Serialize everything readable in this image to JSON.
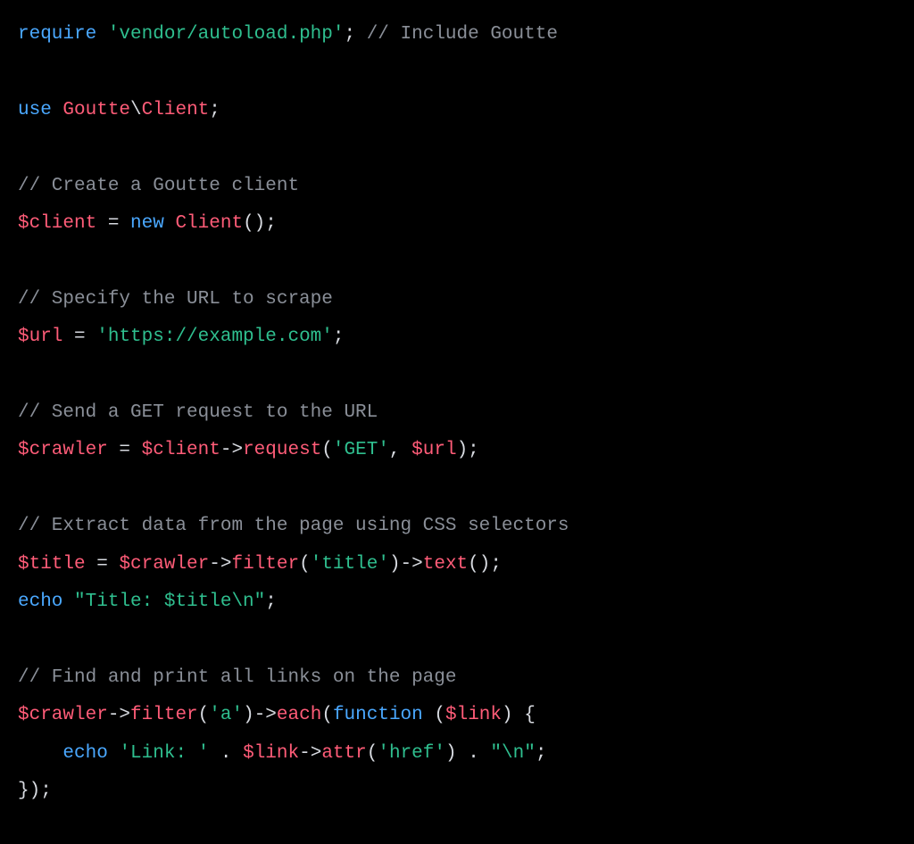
{
  "code": {
    "lines": [
      [
        {
          "cls": "tok-keyword",
          "text": "require"
        },
        {
          "cls": "tok-punct",
          "text": " "
        },
        {
          "cls": "tok-string",
          "text": "'vendor/autoload.php'"
        },
        {
          "cls": "tok-punct",
          "text": ";"
        },
        {
          "cls": "tok-punct",
          "text": " "
        },
        {
          "cls": "tok-comment",
          "text": "// Include Goutte"
        }
      ],
      [],
      [
        {
          "cls": "tok-keyword",
          "text": "use"
        },
        {
          "cls": "tok-punct",
          "text": " "
        },
        {
          "cls": "tok-class",
          "text": "Goutte"
        },
        {
          "cls": "tok-punct",
          "text": "\\"
        },
        {
          "cls": "tok-class",
          "text": "Client"
        },
        {
          "cls": "tok-punct",
          "text": ";"
        }
      ],
      [],
      [
        {
          "cls": "tok-comment",
          "text": "// Create a Goutte client"
        }
      ],
      [
        {
          "cls": "tok-var",
          "text": "$client"
        },
        {
          "cls": "tok-punct",
          "text": " = "
        },
        {
          "cls": "tok-keyword",
          "text": "new"
        },
        {
          "cls": "tok-punct",
          "text": " "
        },
        {
          "cls": "tok-class",
          "text": "Client"
        },
        {
          "cls": "tok-punct",
          "text": "();"
        }
      ],
      [],
      [
        {
          "cls": "tok-comment",
          "text": "// Specify the URL to scrape"
        }
      ],
      [
        {
          "cls": "tok-var",
          "text": "$url"
        },
        {
          "cls": "tok-punct",
          "text": " = "
        },
        {
          "cls": "tok-string",
          "text": "'https://example.com'"
        },
        {
          "cls": "tok-punct",
          "text": ";"
        }
      ],
      [],
      [
        {
          "cls": "tok-comment",
          "text": "// Send a GET request to the URL"
        }
      ],
      [
        {
          "cls": "tok-var",
          "text": "$crawler"
        },
        {
          "cls": "tok-punct",
          "text": " = "
        },
        {
          "cls": "tok-var",
          "text": "$client"
        },
        {
          "cls": "tok-punct",
          "text": "->"
        },
        {
          "cls": "tok-func",
          "text": "request"
        },
        {
          "cls": "tok-punct",
          "text": "("
        },
        {
          "cls": "tok-string",
          "text": "'GET'"
        },
        {
          "cls": "tok-punct",
          "text": ", "
        },
        {
          "cls": "tok-var",
          "text": "$url"
        },
        {
          "cls": "tok-punct",
          "text": ");"
        }
      ],
      [],
      [
        {
          "cls": "tok-comment",
          "text": "// Extract data from the page using CSS selectors"
        }
      ],
      [
        {
          "cls": "tok-var",
          "text": "$title"
        },
        {
          "cls": "tok-punct",
          "text": " = "
        },
        {
          "cls": "tok-var",
          "text": "$crawler"
        },
        {
          "cls": "tok-punct",
          "text": "->"
        },
        {
          "cls": "tok-func",
          "text": "filter"
        },
        {
          "cls": "tok-punct",
          "text": "("
        },
        {
          "cls": "tok-string",
          "text": "'title'"
        },
        {
          "cls": "tok-punct",
          "text": ")->"
        },
        {
          "cls": "tok-func",
          "text": "text"
        },
        {
          "cls": "tok-punct",
          "text": "();"
        }
      ],
      [
        {
          "cls": "tok-keyword",
          "text": "echo"
        },
        {
          "cls": "tok-punct",
          "text": " "
        },
        {
          "cls": "tok-string",
          "text": "\"Title: $title\\n\""
        },
        {
          "cls": "tok-punct",
          "text": ";"
        }
      ],
      [],
      [
        {
          "cls": "tok-comment",
          "text": "// Find and print all links on the page"
        }
      ],
      [
        {
          "cls": "tok-var",
          "text": "$crawler"
        },
        {
          "cls": "tok-punct",
          "text": "->"
        },
        {
          "cls": "tok-func",
          "text": "filter"
        },
        {
          "cls": "tok-punct",
          "text": "("
        },
        {
          "cls": "tok-string",
          "text": "'a'"
        },
        {
          "cls": "tok-punct",
          "text": ")->"
        },
        {
          "cls": "tok-func",
          "text": "each"
        },
        {
          "cls": "tok-punct",
          "text": "("
        },
        {
          "cls": "tok-keyword",
          "text": "function"
        },
        {
          "cls": "tok-punct",
          "text": " ("
        },
        {
          "cls": "tok-var",
          "text": "$link"
        },
        {
          "cls": "tok-punct",
          "text": ") {"
        }
      ],
      [
        {
          "cls": "tok-punct",
          "text": "    "
        },
        {
          "cls": "tok-keyword",
          "text": "echo"
        },
        {
          "cls": "tok-punct",
          "text": " "
        },
        {
          "cls": "tok-string",
          "text": "'Link: '"
        },
        {
          "cls": "tok-punct",
          "text": " . "
        },
        {
          "cls": "tok-var",
          "text": "$link"
        },
        {
          "cls": "tok-punct",
          "text": "->"
        },
        {
          "cls": "tok-func",
          "text": "attr"
        },
        {
          "cls": "tok-punct",
          "text": "("
        },
        {
          "cls": "tok-string",
          "text": "'href'"
        },
        {
          "cls": "tok-punct",
          "text": ") . "
        },
        {
          "cls": "tok-string",
          "text": "\"\\n\""
        },
        {
          "cls": "tok-punct",
          "text": ";"
        }
      ],
      [
        {
          "cls": "tok-punct",
          "text": "});"
        }
      ]
    ]
  }
}
